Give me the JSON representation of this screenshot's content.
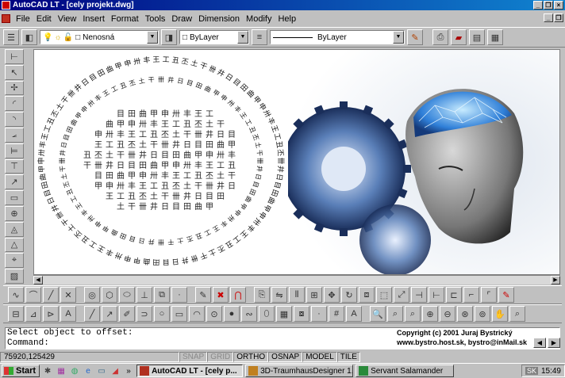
{
  "window": {
    "title": "AutoCAD LT - [cely projekt.dwg]",
    "minimize": "_",
    "restore": "❐",
    "close": "×"
  },
  "menu": {
    "items": [
      "File",
      "Edit",
      "View",
      "Insert",
      "Format",
      "Tools",
      "Draw",
      "Dimension",
      "Modify",
      "Help"
    ]
  },
  "layer_toolbar": {
    "layer_name": "Nenosná",
    "color": "ByLayer",
    "linetype": "ByLayer"
  },
  "command": {
    "line1": "Select object to offset:",
    "line2": "Command:"
  },
  "copyright": {
    "line1": "Copyright (c) 2001 Juraj Bystrický",
    "line2": "www.bystro.host.sk, bystro@inMail.sk"
  },
  "status": {
    "coordinates": "75920,125429",
    "toggles": [
      {
        "label": "SNAP",
        "on": false
      },
      {
        "label": "GRID",
        "on": false
      },
      {
        "label": "ORTHO",
        "on": true
      },
      {
        "label": "OSNAP",
        "on": true
      },
      {
        "label": "MODEL",
        "on": true
      },
      {
        "label": "TILE",
        "on": true
      }
    ]
  },
  "taskbar": {
    "start_label": "Start",
    "overflow": "»",
    "tasks": [
      {
        "label": "AutoCAD LT - [cely p...",
        "active": true
      },
      {
        "label": "3D-TraumhausDesigner 1...",
        "active": false
      },
      {
        "label": "Servant Salamander",
        "active": false
      }
    ],
    "clock": "15:49",
    "tray_label": "SK"
  },
  "colors": {
    "title_start": "#000080",
    "title_end": "#1084d0",
    "face": "#c0c0c0",
    "canvas": "#ffffff"
  }
}
